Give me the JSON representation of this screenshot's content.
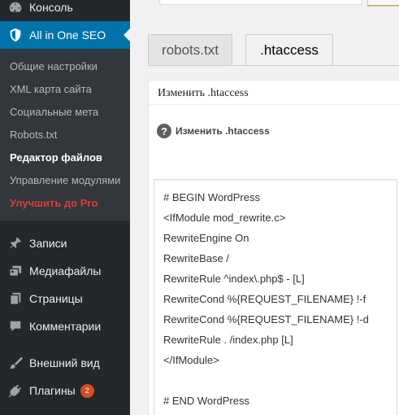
{
  "sidebar": {
    "items": [
      {
        "label": "Консоль",
        "icon": "dashboard-icon"
      },
      {
        "label": "All in One SEO",
        "icon": "shield-icon",
        "current": true
      },
      {
        "label": "Записи",
        "icon": "pin-icon"
      },
      {
        "label": "Медиафайлы",
        "icon": "media-icon"
      },
      {
        "label": "Страницы",
        "icon": "pages-icon"
      },
      {
        "label": "Комментарии",
        "icon": "comment-icon"
      },
      {
        "label": "Внешний вид",
        "icon": "brush-icon"
      },
      {
        "label": "Плагины",
        "icon": "plugin-icon",
        "badge": "2"
      }
    ],
    "submenu": [
      {
        "label": "Общие настройки"
      },
      {
        "label": "XML карта сайта"
      },
      {
        "label": "Социальные мета"
      },
      {
        "label": "Robots.txt"
      },
      {
        "label": "Редактор файлов",
        "current": true
      },
      {
        "label": "Управление модулями"
      },
      {
        "label": "Улучшить до Pro",
        "highlight": true
      }
    ],
    "colors": {
      "background": "#23282d",
      "submenu_bg": "#32373c",
      "active": "#0073aa",
      "pro": "#dd3d36",
      "badge": "#d54e21"
    }
  },
  "tabs": [
    {
      "label": "robots.txt",
      "active": false
    },
    {
      "label": ".htaccess",
      "active": true
    }
  ],
  "panel": {
    "title": "Изменить .htaccess",
    "help_label": "Изменить .htaccess",
    "help_icon": "question-icon"
  },
  "editor": {
    "lines": [
      "# BEGIN WordPress",
      "<IfModule mod_rewrite.c>",
      "RewriteEngine On",
      "RewriteBase /",
      "RewriteRule ^index\\.php$ - [L]",
      "RewriteCond %{REQUEST_FILENAME} !-f",
      "RewriteCond %{REQUEST_FILENAME} !-d",
      "RewriteRule . /index.php [L]",
      "</IfModule>",
      "",
      "# END WordPress"
    ]
  }
}
